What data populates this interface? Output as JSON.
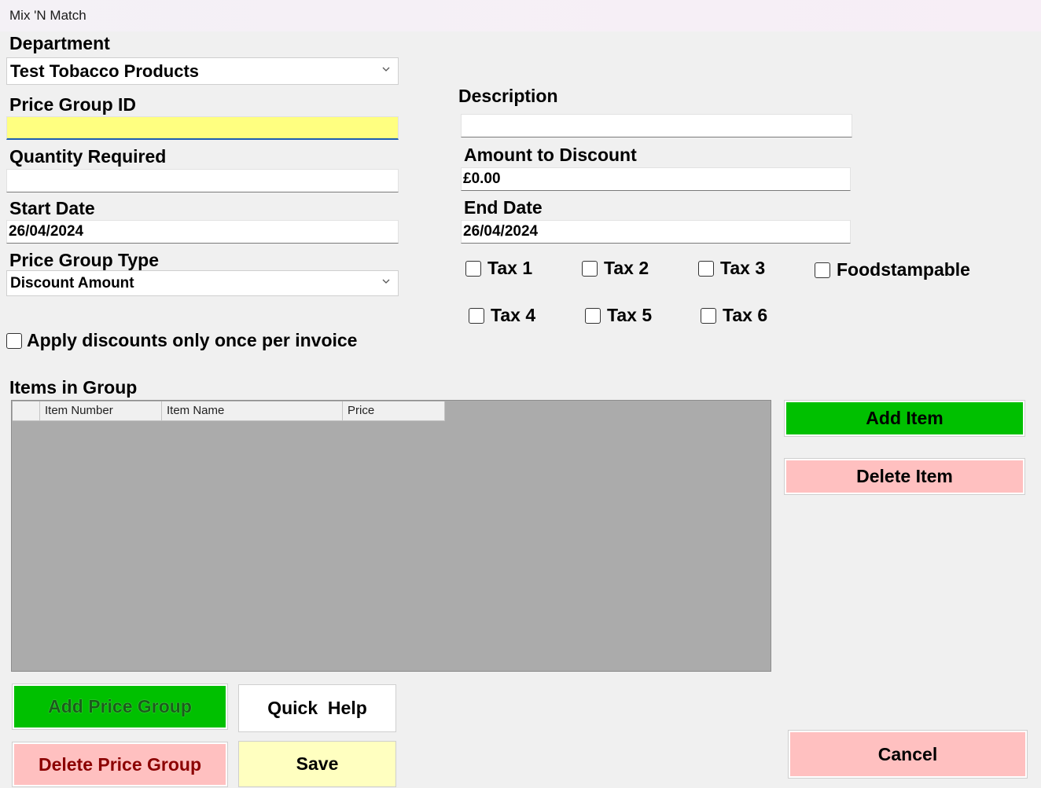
{
  "window": {
    "title": "Mix 'N Match"
  },
  "department": {
    "label": "Department",
    "value": "Test Tobacco Products"
  },
  "price_group_id": {
    "label": "Price Group ID",
    "value": ""
  },
  "quantity_required": {
    "label": "Quantity Required",
    "value": ""
  },
  "start_date": {
    "label": "Start Date",
    "value": "26/04/2024"
  },
  "price_group_type": {
    "label": "Price Group Type",
    "value": "Discount Amount"
  },
  "description": {
    "label": "Description",
    "value": ""
  },
  "amount_to_discount": {
    "label": "Amount to Discount",
    "value": "£0.00"
  },
  "end_date": {
    "label": "End Date",
    "value": "26/04/2024"
  },
  "taxes": {
    "tax1": "Tax 1",
    "tax2": "Tax 2",
    "tax3": "Tax 3",
    "tax4": "Tax 4",
    "tax5": "Tax 5",
    "tax6": "Tax 6",
    "foodstampable": "Foodstampable"
  },
  "apply_once": {
    "label": "Apply discounts only once per invoice"
  },
  "items_in_group": {
    "label": "Items in Group",
    "columns": [
      "Item Number",
      "Item Name",
      "Price"
    ],
    "rows": []
  },
  "buttons": {
    "add_item": "Add Item",
    "delete_item": "Delete Item",
    "add_price_group": "Add Price Group",
    "quick_help": "Quick  Help",
    "delete_price_group": "Delete Price Group",
    "save": "Save",
    "cancel": "Cancel"
  },
  "colors": {
    "green": "#00c000",
    "pink": "#ffc0c0",
    "yellow_field": "#ffff80",
    "save_yellow": "#ffffc0",
    "dark_red_text": "#8b0000",
    "dark_green_text": "#1a5e1a"
  }
}
